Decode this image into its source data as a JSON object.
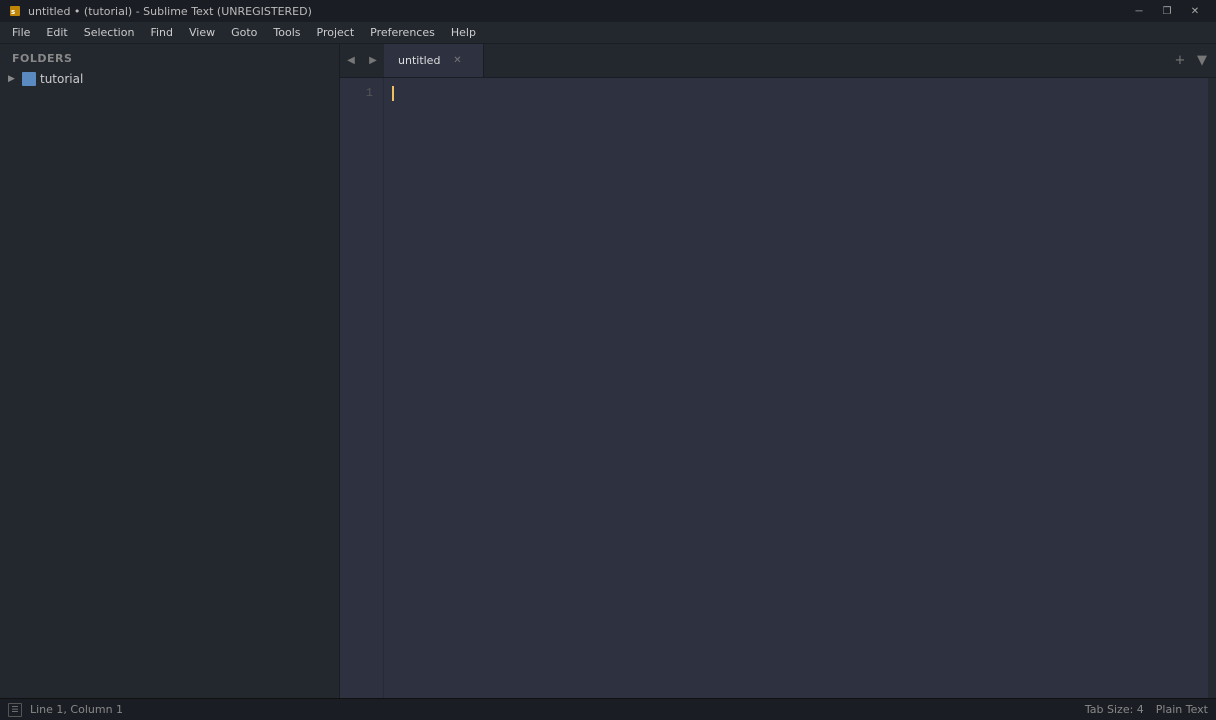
{
  "titlebar": {
    "title": "untitled • (tutorial) - Sublime Text (UNREGISTERED)",
    "minimize_label": "─",
    "restore_label": "❐",
    "close_label": "✕"
  },
  "menubar": {
    "items": [
      "File",
      "Edit",
      "Selection",
      "Find",
      "View",
      "Goto",
      "Tools",
      "Project",
      "Preferences",
      "Help"
    ]
  },
  "sidebar": {
    "folders_label": "FOLDERS",
    "folder": {
      "name": "tutorial",
      "icon_color": "#5a8abf"
    }
  },
  "tabs": {
    "nav_left": "◀",
    "nav_right": "▶",
    "items": [
      {
        "label": "untitled",
        "active": true,
        "modified": true
      }
    ],
    "add_label": "+",
    "overflow_label": "▼"
  },
  "editor": {
    "line_numbers": [
      "1"
    ],
    "content": ""
  },
  "statusbar": {
    "position": "Line 1, Column 1",
    "tab_size": "Tab Size: 4",
    "syntax": "Plain Text"
  }
}
